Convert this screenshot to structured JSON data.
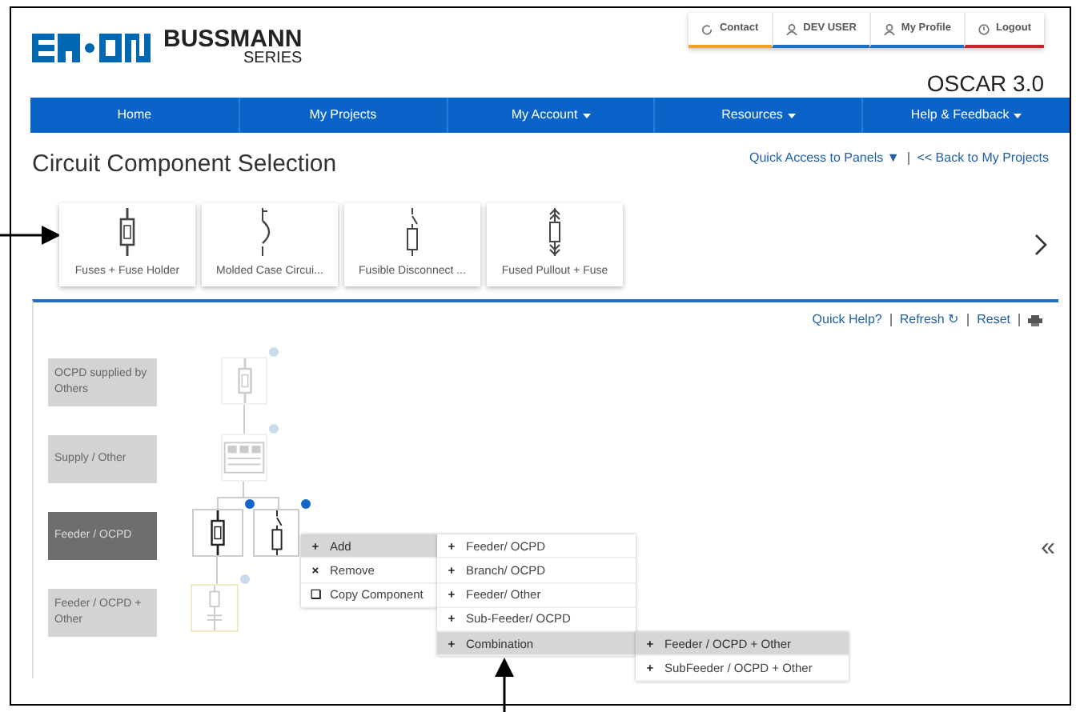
{
  "header": {
    "brand": {
      "name": "BUSSMANN",
      "sub": "SERIES"
    },
    "top_links": [
      {
        "label": "Contact",
        "kind": "refresh",
        "color": "#f0a030"
      },
      {
        "label": "DEV USER",
        "kind": "user",
        "color": "#1f6fc5"
      },
      {
        "label": "My Profile",
        "kind": "user",
        "color": "#1f6fc5"
      },
      {
        "label": "Logout",
        "kind": "power",
        "color": "#c0282d"
      }
    ],
    "app_version": "OSCAR 3.0"
  },
  "nav": [
    {
      "label": "Home",
      "dropdown": false
    },
    {
      "label": "My Projects",
      "dropdown": false
    },
    {
      "label": "My Account",
      "dropdown": true
    },
    {
      "label": "Resources",
      "dropdown": true
    },
    {
      "label": "Help & Feedback",
      "dropdown": true
    }
  ],
  "page_title": "Circuit Component Selection",
  "page_links": [
    "Quick Access to Panels ▼",
    "<< Back to My Projects"
  ],
  "component_cards": [
    {
      "label": "Fuses + Fuse Holder",
      "kind": "fuse"
    },
    {
      "label": "Molded Case Circui...",
      "kind": "breaker"
    },
    {
      "label": "Fusible Disconnect ...",
      "kind": "disconnect"
    },
    {
      "label": "Fused Pullout + Fuse",
      "kind": "pullout"
    }
  ],
  "panel": {
    "toolbar": [
      "Quick Help?",
      "Refresh ↻",
      "Reset"
    ],
    "levels": [
      {
        "label": "OCPD supplied by Others",
        "selected": false
      },
      {
        "label": "Supply / Other",
        "selected": false
      },
      {
        "label": "Feeder / OCPD",
        "selected": true
      },
      {
        "label": "Feeder / OCPD + Other",
        "selected": false
      }
    ],
    "nodes": [
      {
        "kind": "fuse",
        "active": false,
        "highlighted": false
      },
      {
        "kind": "supply",
        "active": false,
        "highlighted": false
      },
      {
        "kind": "fuse",
        "active": true,
        "highlighted": false
      },
      {
        "kind": "disconnect",
        "active": true,
        "highlighted": false
      },
      {
        "kind": "combo",
        "active": false,
        "highlighted": true
      }
    ],
    "context_menu": [
      {
        "icon": "+",
        "label": "Add",
        "selected": true
      },
      {
        "icon": "×",
        "label": "Remove",
        "selected": false
      },
      {
        "icon": "❑",
        "label": "Copy Component",
        "selected": false
      }
    ],
    "submenu": [
      {
        "icon": "+",
        "label": "Feeder/ OCPD",
        "selected": false
      },
      {
        "icon": "+",
        "label": "Branch/ OCPD",
        "selected": false
      },
      {
        "icon": "+",
        "label": "Feeder/ Other",
        "selected": false
      },
      {
        "icon": "+",
        "label": "Sub-Feeder/ OCPD",
        "selected": false
      },
      {
        "icon": "+",
        "label": "Combination",
        "selected": true
      }
    ],
    "combination_menu": [
      {
        "icon": "+",
        "label": "Feeder / OCPD + Other",
        "selected": true
      },
      {
        "icon": "+",
        "label": "SubFeeder / OCPD + Other",
        "selected": false
      }
    ],
    "collapse": "«"
  }
}
